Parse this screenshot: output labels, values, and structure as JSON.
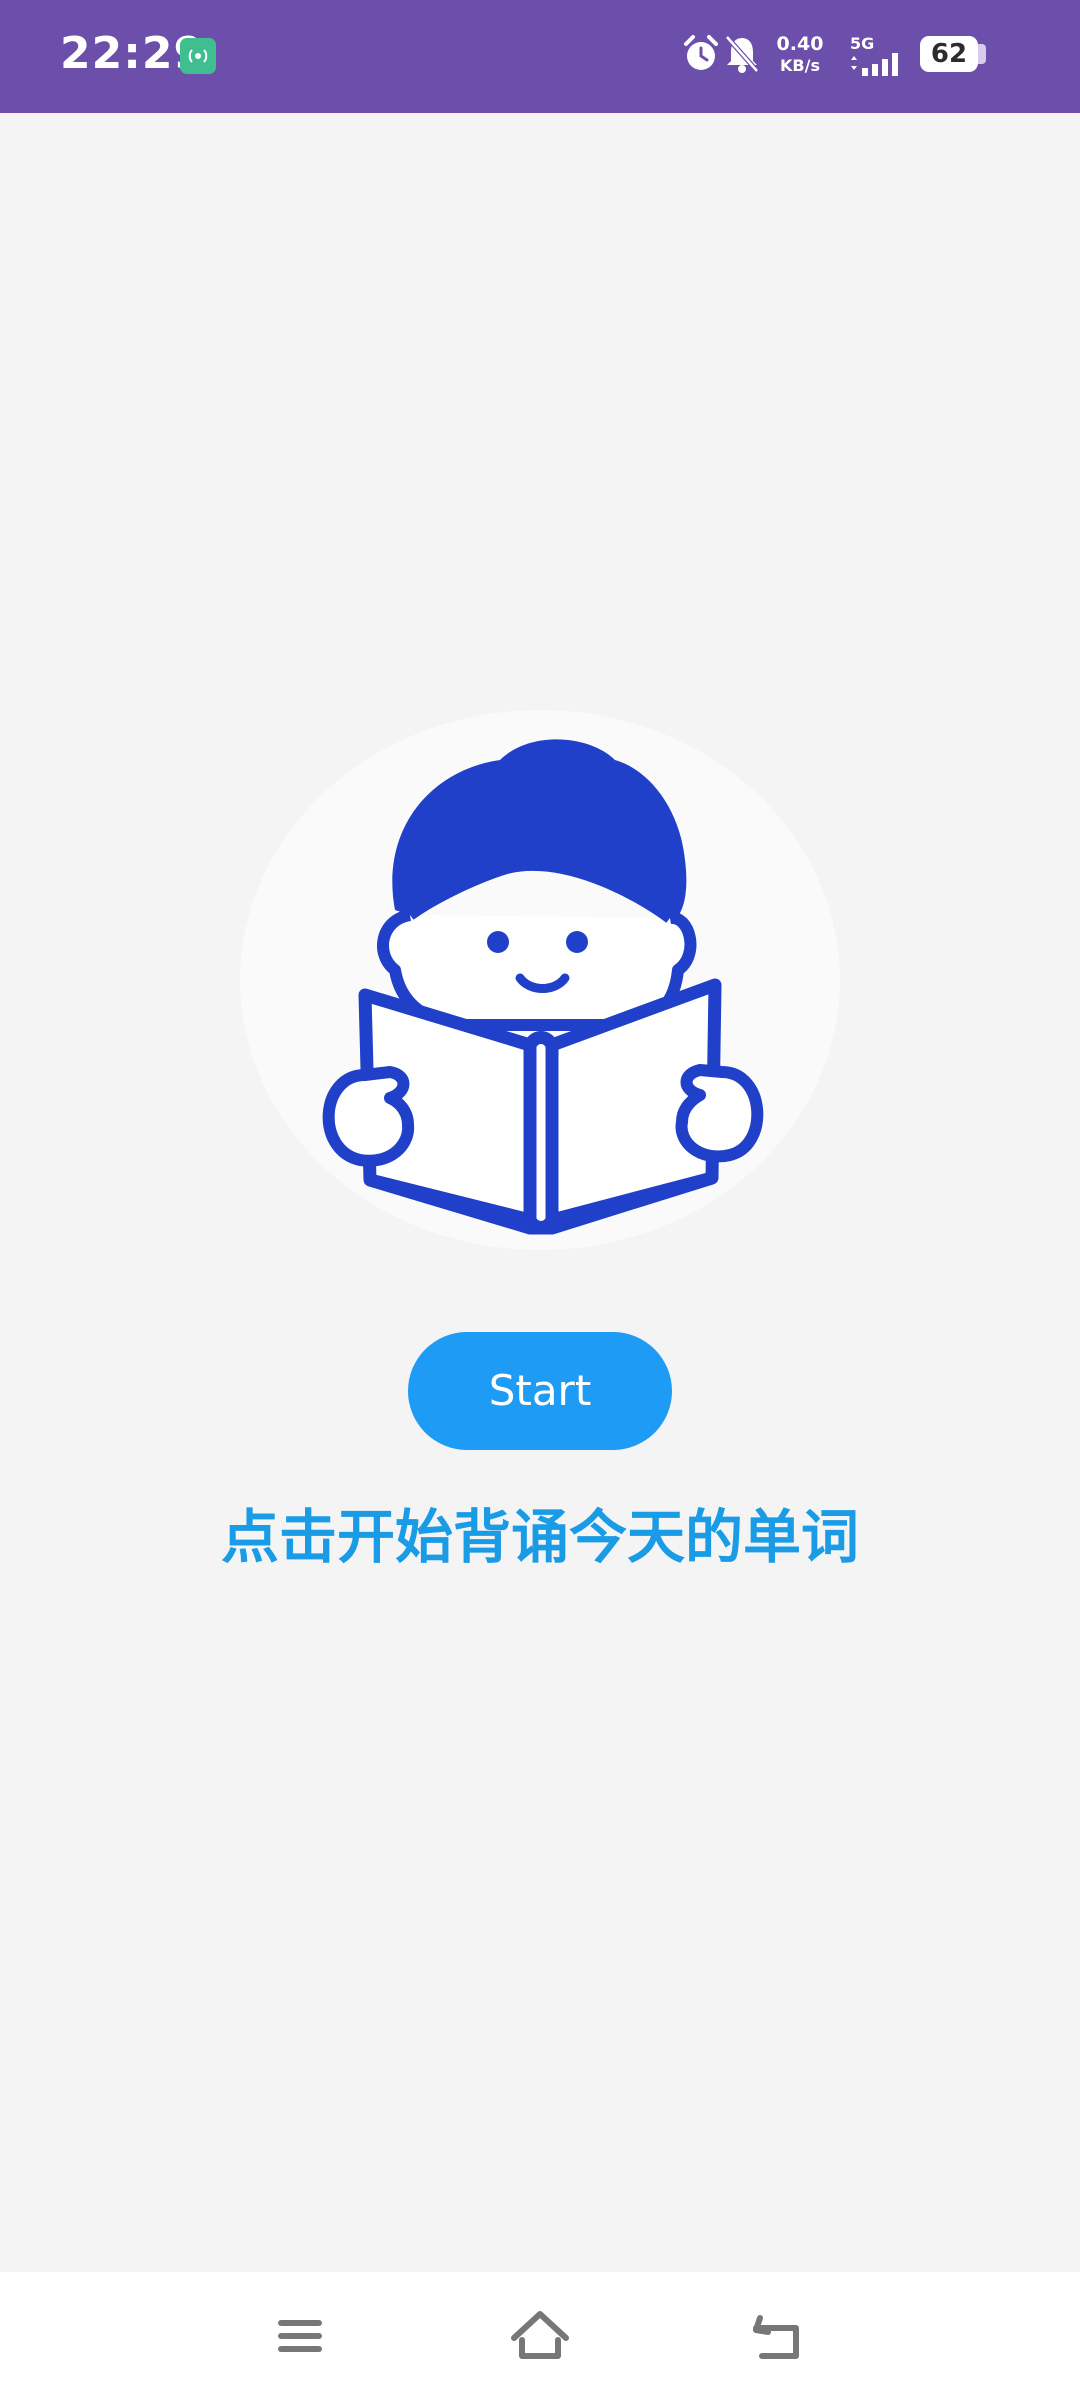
{
  "status_bar": {
    "time": "22:29",
    "net_speed_value": "0.40",
    "net_speed_unit": "KB/s",
    "network_type": "5G",
    "battery_level": "62",
    "icons": [
      "hotspot-icon",
      "alarm-icon",
      "bell-off-icon",
      "signal-icon",
      "battery-icon"
    ],
    "background_color": "#6c4fab"
  },
  "main": {
    "illustration_icon": "boy-reading-book-icon",
    "start_button_label": "Start",
    "hint": "点击开始背诵今天的单词",
    "accent_color": "#1e9bf5",
    "illustration_color": "#2140c9"
  },
  "nav_bar": {
    "icons": [
      "menu-icon",
      "home-icon",
      "back-icon"
    ]
  }
}
